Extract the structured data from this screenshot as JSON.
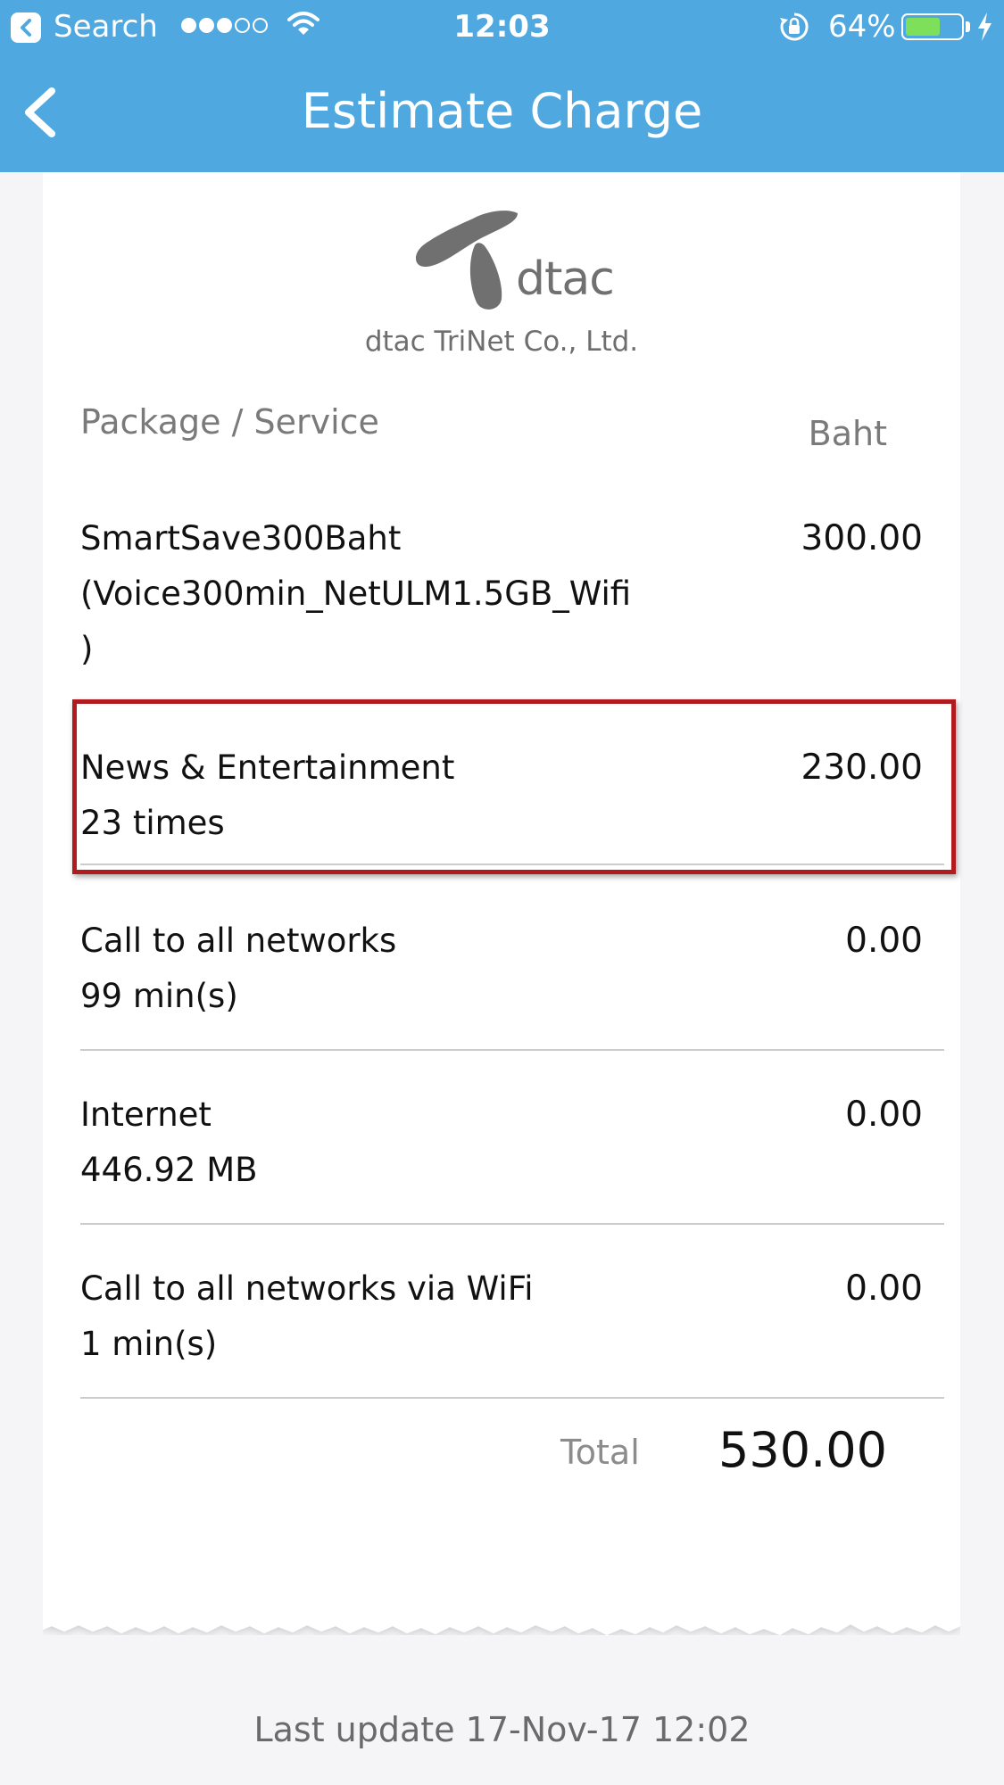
{
  "status_bar": {
    "back_app_label": "Search",
    "time": "12:03",
    "battery_percent": "64%",
    "battery_level": 0.64,
    "signal_bars_filled": 3,
    "signal_bars_total": 5
  },
  "nav": {
    "title": "Estimate Charge",
    "back_icon": "chevron-left-icon"
  },
  "receipt": {
    "logo_text": "dtac",
    "company": "dtac TriNet Co., Ltd.",
    "column_service": "Package / Service",
    "column_amount": "Baht",
    "rows": [
      {
        "name": "SmartSave300Baht\n(Voice300min_NetULM1.5GB_Wifi\n)",
        "amount": "300.00"
      },
      {
        "name": "News & Entertainment\n23 times",
        "amount": "230.00"
      },
      {
        "name": "Call to all networks\n99 min(s)",
        "amount": "0.00"
      },
      {
        "name": "Internet\n446.92 MB",
        "amount": "0.00"
      },
      {
        "name": "Call to all networks via WiFi\n1 min(s)",
        "amount": "0.00"
      }
    ],
    "total_label": "Total",
    "total_value": "530.00"
  },
  "footer": {
    "last_update": "Last update 17-Nov-17 12:02"
  },
  "colors": {
    "header": "#4fa8e0",
    "highlight_border": "#b11a1f",
    "battery": "#7ee05a"
  }
}
